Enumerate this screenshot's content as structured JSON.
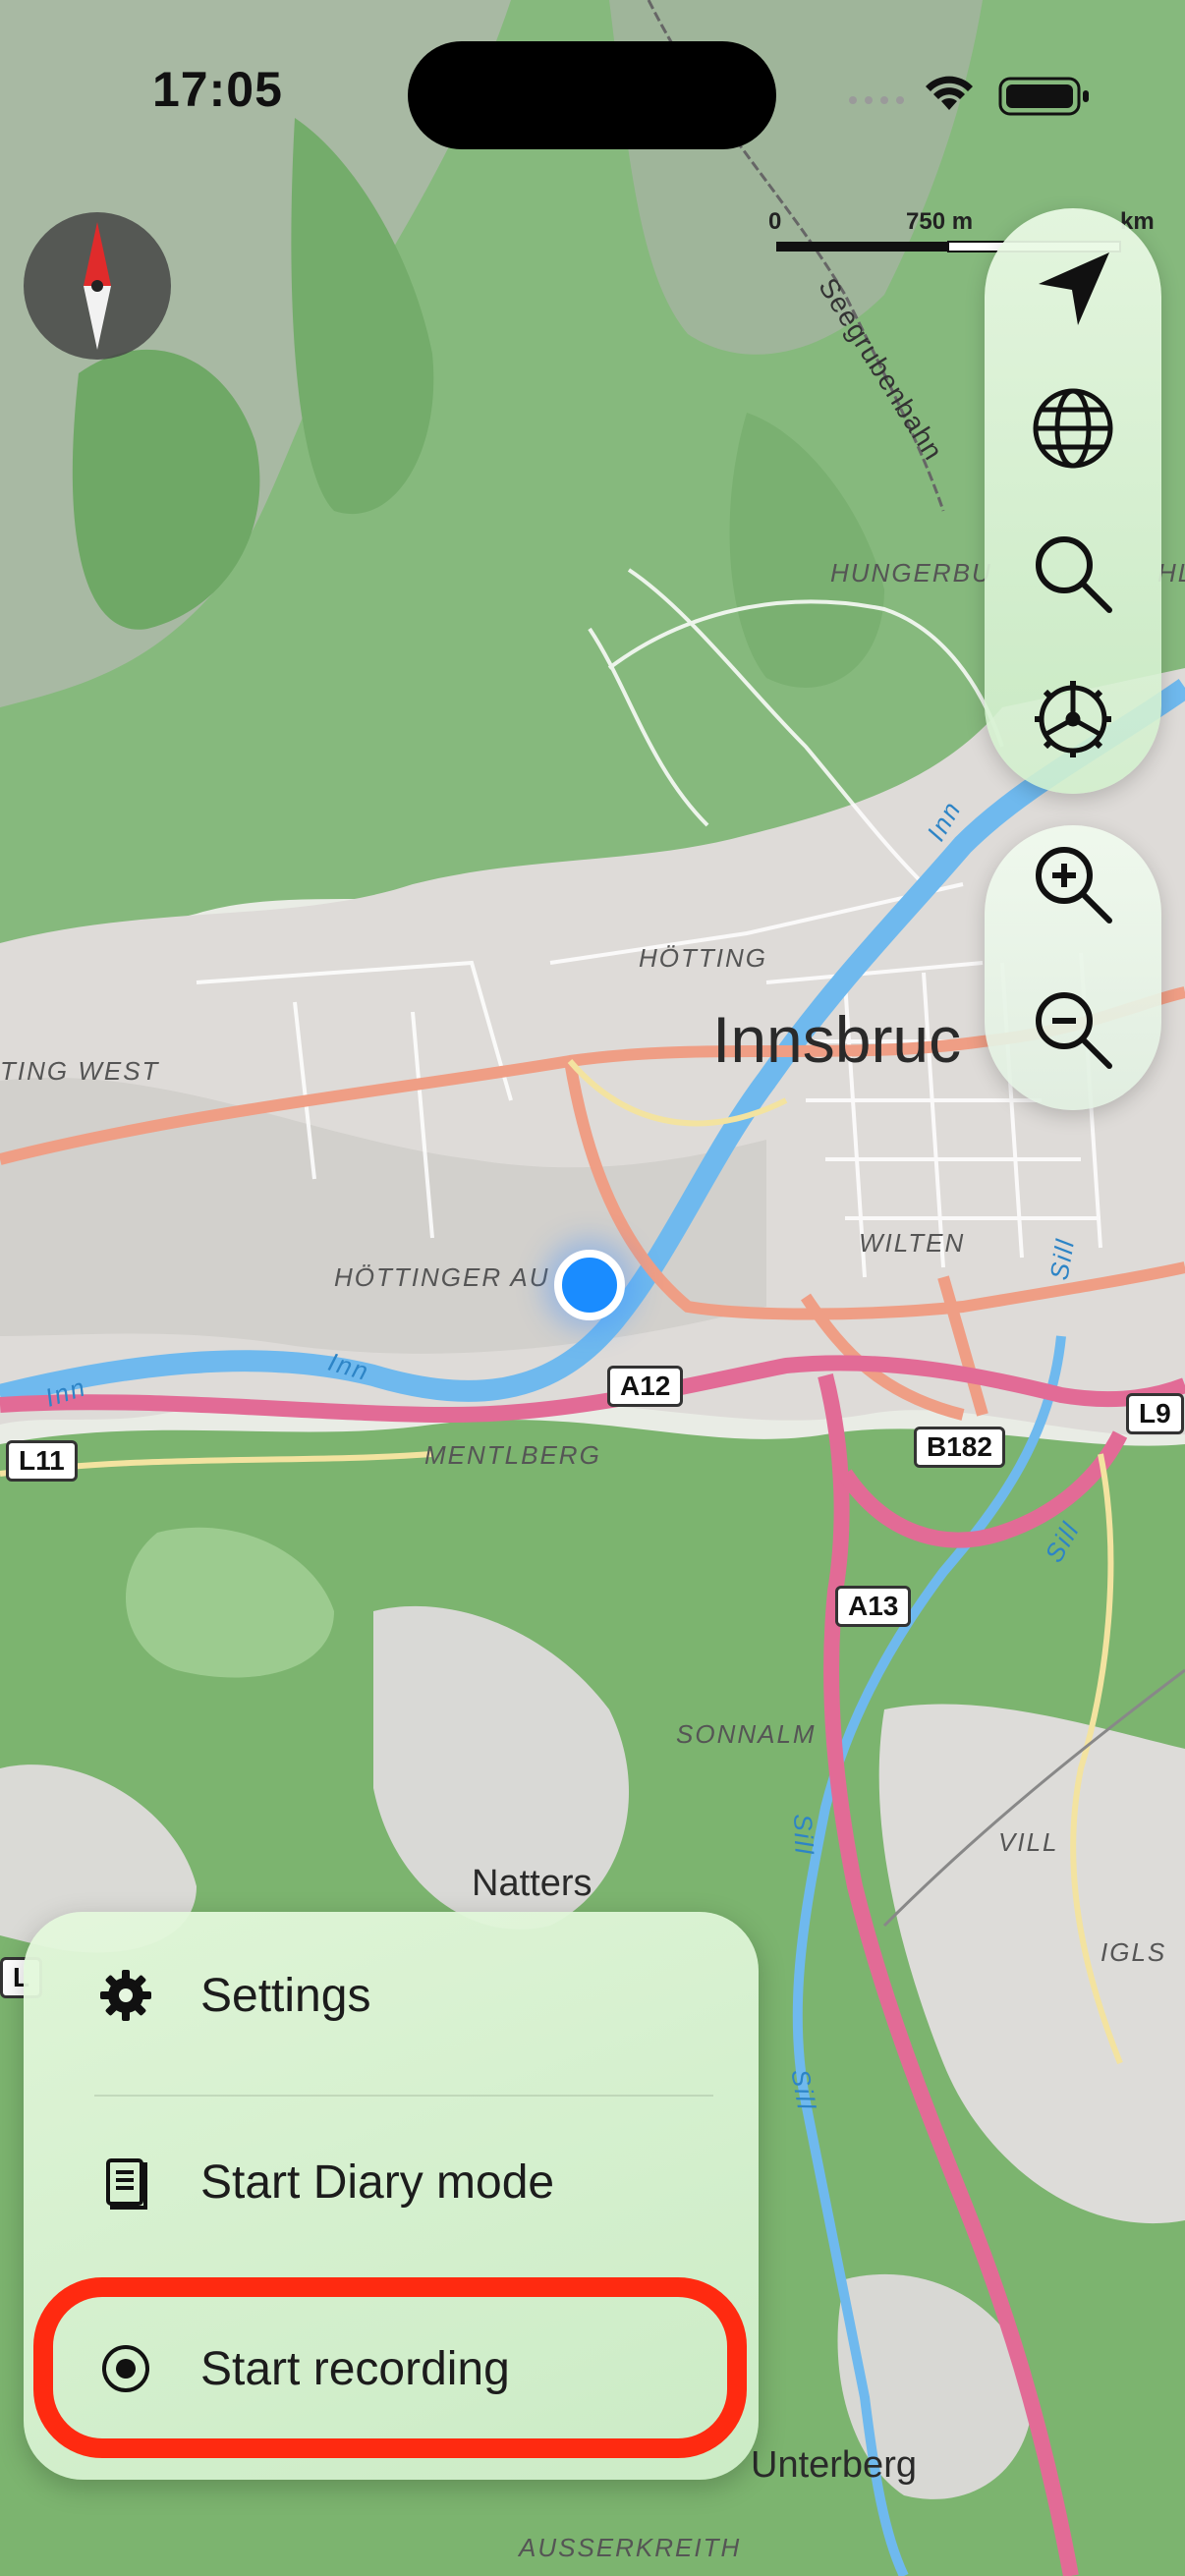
{
  "status_bar": {
    "time": "17:05"
  },
  "scale": {
    "start": "0",
    "mid": "750 m",
    "end": "km"
  },
  "map_labels": {
    "city": "Innsbruc",
    "hotting": "HÖTTING",
    "hotting_west": "TING WEST",
    "hottinger_au": "HÖTTINGER AU",
    "mentlberg": "MENTLBERG",
    "wilten": "WILTEN",
    "hungerburg": "HUNGERBU",
    "seegrubenbahn": "Seegrubenbahn",
    "natters": "Natters",
    "sonnalm": "SONNALM",
    "vill": "VILL",
    "igls": "IGLS",
    "unterberg": "Unterberg",
    "ausserkreith": "AUSSERKREITH",
    "river_inn_1": "Inn",
    "river_inn_2": "Inn",
    "river_inn_3": "Inn",
    "river_sill_1": "Sill",
    "river_sill_2": "Sill",
    "river_sill_3": "Sill",
    "hl": "HL"
  },
  "road_shields": {
    "a12": "A12",
    "a13": "A13",
    "b182": "B182",
    "l9": "L9",
    "l11": "L11",
    "l_partial": "L"
  },
  "controls": {
    "icons": [
      "location-arrow-icon",
      "globe-icon",
      "search-icon",
      "settings-wheel-icon",
      "zoom-in-icon",
      "zoom-out-icon"
    ]
  },
  "menu": {
    "items": [
      {
        "label": "Settings",
        "icon": "gear-icon"
      },
      {
        "label": "Start Diary mode",
        "icon": "diary-icon"
      },
      {
        "label": "Start recording",
        "icon": "record-icon"
      }
    ]
  },
  "colors": {
    "highlight": "#ff2a10",
    "location_dot": "#1a8cff",
    "forest": "#7fb873",
    "urban": "#dcdcdc",
    "motorway": "#e26b96",
    "river": "#6fb9ee"
  }
}
